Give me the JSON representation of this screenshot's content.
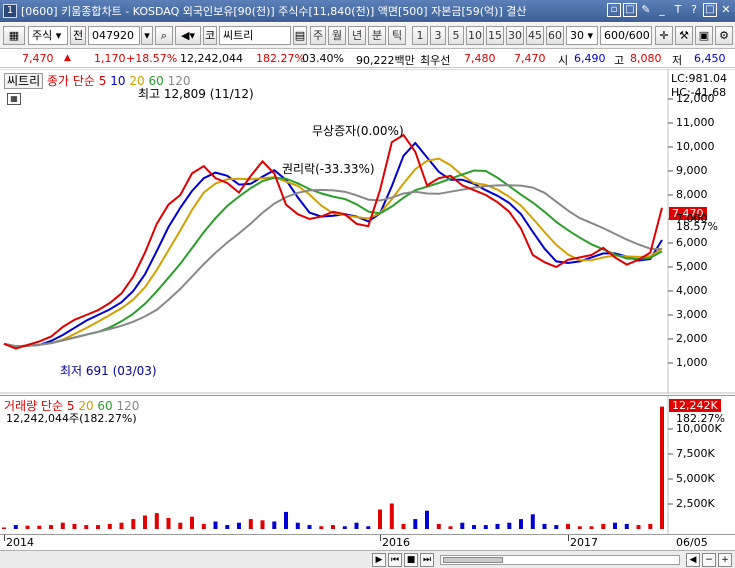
{
  "title": {
    "app_num": "1",
    "text": "[0600] 키움종합차트 - KOSDAQ 외국인보유[90(천)] 주식수[11,840(천)] 액면[500] 자본금[59(억)] 결산"
  },
  "toolbar": {
    "market": "주식",
    "prefix": "전",
    "code": "047920",
    "market_tag": "코",
    "stock_name": "씨트리",
    "period_btns": [
      "주",
      "월",
      "년",
      "분",
      "틱"
    ],
    "num_btns": [
      "1",
      "3",
      "5",
      "10",
      "15",
      "30",
      "45",
      "60"
    ],
    "interval_value": "30",
    "page_count": "600/600"
  },
  "quote": {
    "price": "7,470",
    "change": "1,170",
    "change_pct": "+18.57%",
    "volume": "12,242,044",
    "vol_ratio": "182.27%",
    "turnover": "03.40%",
    "amount": "90,222백만",
    "ask_label": "최우선",
    "ask1": "7,480",
    "ask2": "7,470",
    "open_label": "시",
    "open": "6,490",
    "high_label": "고",
    "high": "8,080",
    "low_label": "저",
    "low": "6,450"
  },
  "price_pane": {
    "name_tag": "씨트리",
    "ind_name": "종가 단순",
    "ma_periods": [
      "5",
      "10",
      "20",
      "60",
      "120"
    ],
    "ma_colors": [
      "#e00000",
      "#0000d0",
      "#d4a000",
      "#2aa02a",
      "#888888"
    ],
    "high_ann": "최고 12,809 (11/12)",
    "low_ann": "최저 691 (03/03)",
    "ann1": "무상증자(0.00%)",
    "ann2": "권리락(-33.33%)",
    "lc": "LC:981.04",
    "hc": "HC:-41.68",
    "last_price": "7,470",
    "last_pct": "18.57%",
    "y_ticks": [
      "12,000",
      "11,000",
      "10,000",
      "9,000",
      "8,000",
      "7,000",
      "6,000",
      "5,000",
      "4,000",
      "3,000",
      "2,000",
      "1,000"
    ]
  },
  "vol_pane": {
    "ind_name": "거래량 단순",
    "ma_periods": [
      "5",
      "20",
      "60",
      "120"
    ],
    "value_text": "12,242,044주(182.27%)",
    "last_vol": "12,242K",
    "last_pct": "182.27%",
    "y_ticks": [
      "10,000K",
      "7,500K",
      "5,000K",
      "2,500K"
    ]
  },
  "x_axis": {
    "labels": [
      "2014",
      "2016",
      "2017"
    ],
    "date_right": "06/05"
  },
  "chart_data": {
    "type": "line",
    "title": "",
    "x": [
      "2014",
      "",
      "",
      "",
      "",
      "",
      "",
      "",
      "",
      "",
      "",
      "",
      "",
      "",
      "",
      "",
      "",
      "",
      "",
      "",
      "",
      "",
      "",
      "",
      "",
      "",
      "",
      "",
      "",
      "",
      "",
      "",
      "2016",
      "",
      "",
      "",
      "",
      "",
      "",
      "",
      "",
      "",
      "",
      "",
      "",
      "",
      "",
      "",
      "2017",
      "",
      "",
      "",
      "",
      "",
      ""
    ],
    "series": [
      {
        "values": [
          1800,
          1600,
          1750,
          1900,
          2100,
          2500,
          2800,
          3000,
          3200,
          3500,
          3900,
          4600,
          5600,
          6800,
          7600,
          8000,
          8900,
          9200,
          8700,
          8500,
          8100,
          8800,
          9400,
          8900,
          7600,
          7200,
          7000,
          7100,
          7300,
          7200,
          6800,
          6700,
          8200,
          10200,
          10500,
          9800,
          8400,
          8700,
          8800,
          8400,
          8200,
          8000,
          7700,
          7300,
          6600,
          5500,
          5200,
          5000,
          5300,
          5400,
          5500,
          5800,
          5400,
          5100,
          5300,
          5600,
          7470
        ]
      }
    ],
    "ylim": [
      0,
      13000
    ]
  }
}
